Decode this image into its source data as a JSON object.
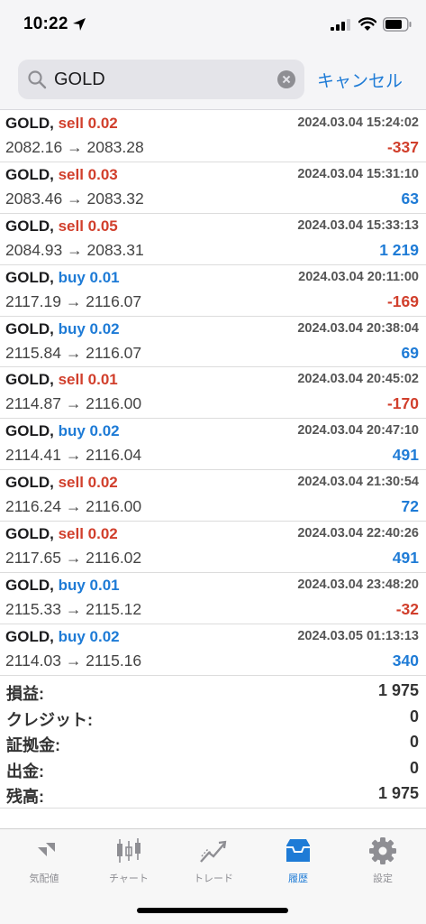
{
  "status_bar": {
    "time": "10:22"
  },
  "search": {
    "query": "GOLD",
    "cancel_label": "キャンセル"
  },
  "trades": [
    {
      "symbol": "GOLD,",
      "side": "sell 0.02",
      "type": "sell",
      "time": "2024.03.04 15:24:02",
      "prices": "2082.16 → 2083.28",
      "profit": "-337",
      "profit_sign": "neg"
    },
    {
      "symbol": "GOLD,",
      "side": "sell 0.03",
      "type": "sell",
      "time": "2024.03.04 15:31:10",
      "prices": "2083.46 → 2083.32",
      "profit": "63",
      "profit_sign": "pos"
    },
    {
      "symbol": "GOLD,",
      "side": "sell 0.05",
      "type": "sell",
      "time": "2024.03.04 15:33:13",
      "prices": "2084.93 → 2083.31",
      "profit": "1 219",
      "profit_sign": "pos"
    },
    {
      "symbol": "GOLD,",
      "side": "buy 0.01",
      "type": "buy",
      "time": "2024.03.04 20:11:00",
      "prices": "2117.19 → 2116.07",
      "profit": "-169",
      "profit_sign": "neg"
    },
    {
      "symbol": "GOLD,",
      "side": "buy 0.02",
      "type": "buy",
      "time": "2024.03.04 20:38:04",
      "prices": "2115.84 → 2116.07",
      "profit": "69",
      "profit_sign": "pos"
    },
    {
      "symbol": "GOLD,",
      "side": "sell 0.01",
      "type": "sell",
      "time": "2024.03.04 20:45:02",
      "prices": "2114.87 → 2116.00",
      "profit": "-170",
      "profit_sign": "neg"
    },
    {
      "symbol": "GOLD,",
      "side": "buy 0.02",
      "type": "buy",
      "time": "2024.03.04 20:47:10",
      "prices": "2114.41 → 2116.04",
      "profit": "491",
      "profit_sign": "pos"
    },
    {
      "symbol": "GOLD,",
      "side": "sell 0.02",
      "type": "sell",
      "time": "2024.03.04 21:30:54",
      "prices": "2116.24 → 2116.00",
      "profit": "72",
      "profit_sign": "pos"
    },
    {
      "symbol": "GOLD,",
      "side": "sell 0.02",
      "type": "sell",
      "time": "2024.03.04 22:40:26",
      "prices": "2117.65 → 2116.02",
      "profit": "491",
      "profit_sign": "pos"
    },
    {
      "symbol": "GOLD,",
      "side": "buy 0.01",
      "type": "buy",
      "time": "2024.03.04 23:48:20",
      "prices": "2115.33 → 2115.12",
      "profit": "-32",
      "profit_sign": "neg"
    },
    {
      "symbol": "GOLD,",
      "side": "buy 0.02",
      "type": "buy",
      "time": "2024.03.05 01:13:13",
      "prices": "2114.03 → 2115.16",
      "profit": "340",
      "profit_sign": "pos"
    }
  ],
  "summary": [
    {
      "label": "損益:",
      "value": "1 975"
    },
    {
      "label": "クレジット:",
      "value": "0"
    },
    {
      "label": "証拠金:",
      "value": "0"
    },
    {
      "label": "出金:",
      "value": "0"
    },
    {
      "label": "残高:",
      "value": "1 975"
    }
  ],
  "tabs": [
    {
      "label": "気配値",
      "icon": "quotes-icon",
      "active": false
    },
    {
      "label": "チャート",
      "icon": "chart-icon",
      "active": false
    },
    {
      "label": "トレード",
      "icon": "trade-icon",
      "active": false
    },
    {
      "label": "履歴",
      "icon": "history-icon",
      "active": true
    },
    {
      "label": "設定",
      "icon": "settings-icon",
      "active": false
    }
  ],
  "colors": {
    "sell": "#d13f2c",
    "buy": "#1e7bd6",
    "negative": "#d13f2c",
    "positive": "#1e7bd6",
    "accent": "#1e7bd6"
  }
}
